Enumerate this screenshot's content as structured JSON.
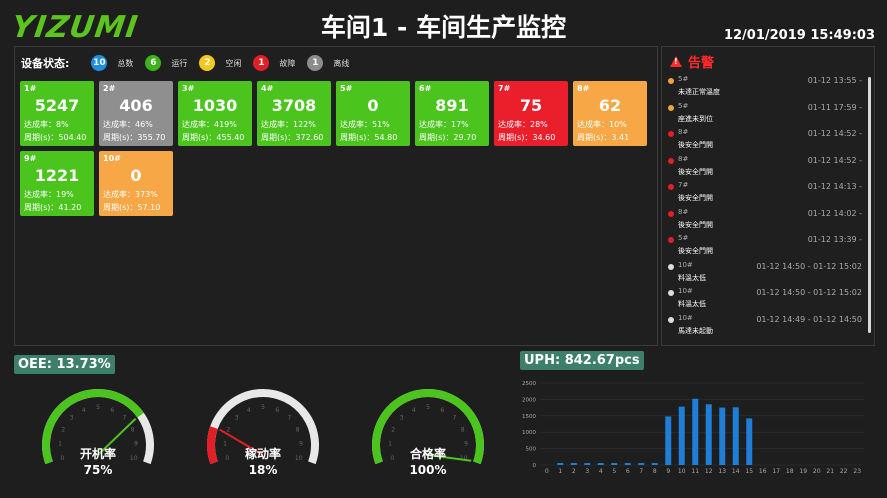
{
  "header": {
    "logo": "YIZUMI",
    "title": "车间1 - 车间生产监控",
    "datetime": "12/01/2019 15:49:03"
  },
  "status": {
    "label": "设备状态:",
    "legend": [
      {
        "count": "10",
        "label": "总数",
        "color": "#1e8fe0"
      },
      {
        "count": "6",
        "label": "运行",
        "color": "#3cb31d"
      },
      {
        "count": "2",
        "label": "空闲",
        "color": "#f3c91b"
      },
      {
        "count": "1",
        "label": "故障",
        "color": "#e21f26"
      },
      {
        "count": "1",
        "label": "离线",
        "color": "#8c8c8c"
      }
    ]
  },
  "machines": [
    {
      "id": "1#",
      "value": "5247",
      "rate": "达成率：8%",
      "cycle": "周期(s)：504.40",
      "color": "#4bc41e"
    },
    {
      "id": "2#",
      "value": "406",
      "rate": "达成率：46%",
      "cycle": "周期(s)：355.70",
      "color": "#8f8f8f"
    },
    {
      "id": "3#",
      "value": "1030",
      "rate": "达成率：419%",
      "cycle": "周期(s)：455.40",
      "color": "#4bc41e"
    },
    {
      "id": "4#",
      "value": "3708",
      "rate": "达成率：122%",
      "cycle": "周期(s)：372.60",
      "color": "#4bc41e"
    },
    {
      "id": "5#",
      "value": "0",
      "rate": "达成率：51%",
      "cycle": "周期(s)：54.80",
      "color": "#4bc41e"
    },
    {
      "id": "6#",
      "value": "891",
      "rate": "达成率：17%",
      "cycle": "周期(s)：29.70",
      "color": "#4bc41e"
    },
    {
      "id": "7#",
      "value": "75",
      "rate": "达成率：28%",
      "cycle": "周期(s)：34.60",
      "color": "#eb1f2b"
    },
    {
      "id": "8#",
      "value": "62",
      "rate": "达成率：10%",
      "cycle": "周期(s)：3.41",
      "color": "#f7a745"
    },
    {
      "id": "9#",
      "value": "1221",
      "rate": "达成率：19%",
      "cycle": "周期(s)：41.20",
      "color": "#4bc41e"
    },
    {
      "id": "10#",
      "value": "0",
      "rate": "达成率：373%",
      "cycle": "周期(s)：57.10",
      "color": "#f7a745"
    }
  ],
  "alarms": {
    "title": "告警",
    "items": [
      {
        "machine": "5#",
        "msg": "未達正常溫度",
        "time": "01-12 13:55 -",
        "dot": "#f2a33a"
      },
      {
        "machine": "5#",
        "msg": "座進未到位",
        "time": "01-11 17:59 -",
        "dot": "#f2a33a"
      },
      {
        "machine": "8#",
        "msg": "後安全門開",
        "time": "01-12 14:52 -",
        "dot": "#e21f26"
      },
      {
        "machine": "8#",
        "msg": "後安全門開",
        "time": "01-12 14:52 -",
        "dot": "#e21f26"
      },
      {
        "machine": "7#",
        "msg": "後安全門開",
        "time": "01-12 14:13 -",
        "dot": "#e21f26"
      },
      {
        "machine": "8#",
        "msg": "後安全門開",
        "time": "01-12 14:02 -",
        "dot": "#e21f26"
      },
      {
        "machine": "5#",
        "msg": "後安全門開",
        "time": "01-12 13:39 -",
        "dot": "#e21f26"
      },
      {
        "machine": "10#",
        "msg": "料溫太低",
        "time": "01-12 14:50 - 01-12 15:02",
        "dot": "#dddddd"
      },
      {
        "machine": "10#",
        "msg": "料溫太低",
        "time": "01-12 14:50 - 01-12 15:02",
        "dot": "#dddddd"
      },
      {
        "machine": "10#",
        "msg": "馬達未起動",
        "time": "01-12 14:49 - 01-12 14:50",
        "dot": "#dddddd"
      }
    ]
  },
  "oee": {
    "label": "OEE: 13.73%"
  },
  "gauges": [
    {
      "label": "开机率",
      "value": "75%",
      "fraction": 0.75,
      "color": "#4bc41e",
      "needle": "#4bc41e"
    },
    {
      "label": "稼动率",
      "value": "18%",
      "fraction": 0.18,
      "color": "#e21f26",
      "needle": "#e21f26"
    },
    {
      "label": "合格率",
      "value": "100%",
      "fraction": 1.0,
      "color": "#4bc41e",
      "needle": "#4bc41e"
    }
  ],
  "gauge_ticks": [
    "0",
    "1",
    "2",
    "3",
    "4",
    "5",
    "6",
    "7",
    "8",
    "9",
    "10"
  ],
  "uph": {
    "label": "UPH: 842.67pcs"
  },
  "chart_data": {
    "type": "bar",
    "categories": [
      "0",
      "1",
      "2",
      "3",
      "4",
      "5",
      "6",
      "7",
      "8",
      "9",
      "10",
      "11",
      "12",
      "13",
      "14",
      "15",
      "16",
      "17",
      "18",
      "19",
      "20",
      "21",
      "22",
      "23"
    ],
    "values": [
      0,
      60,
      60,
      60,
      60,
      60,
      60,
      60,
      60,
      1480,
      1780,
      2020,
      1850,
      1750,
      1760,
      1420,
      0,
      0,
      0,
      0,
      0,
      0,
      0,
      0
    ],
    "ylim": [
      0,
      2500
    ],
    "yticks": [
      "0",
      "500",
      "1000",
      "1500",
      "2000",
      "2500"
    ],
    "bar_color": "#1f7fd8",
    "grid": true
  }
}
